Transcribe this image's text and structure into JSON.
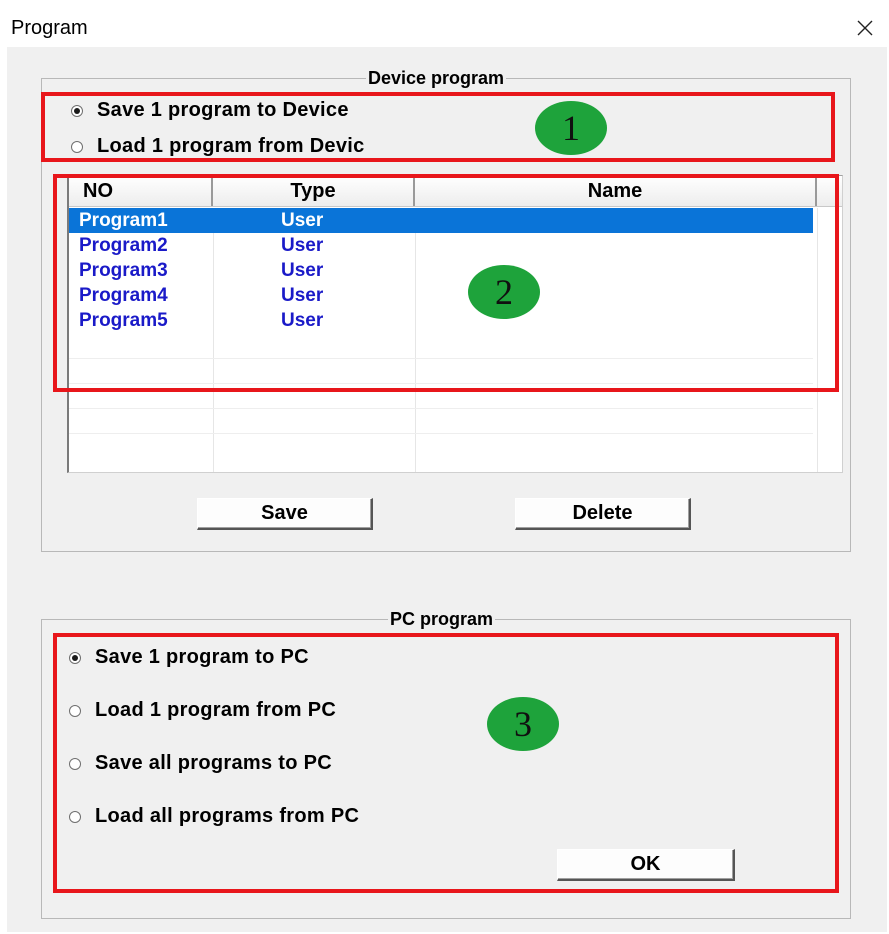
{
  "window": {
    "title": "Program"
  },
  "device_program": {
    "legend": "Device program",
    "options": [
      {
        "label": "Save 1 program to Device",
        "checked": true
      },
      {
        "label": "Load 1 program from Devic",
        "checked": false
      }
    ],
    "list": {
      "columns": [
        "NO",
        "Type",
        "Name"
      ],
      "rows": [
        {
          "no": "Program1",
          "type": "User",
          "name": "",
          "selected": true
        },
        {
          "no": "Program2",
          "type": "User",
          "name": "",
          "selected": false
        },
        {
          "no": "Program3",
          "type": "User",
          "name": "",
          "selected": false
        },
        {
          "no": "Program4",
          "type": "User",
          "name": "",
          "selected": false
        },
        {
          "no": "Program5",
          "type": "User",
          "name": "",
          "selected": false
        }
      ]
    },
    "buttons": {
      "save": "Save",
      "delete": "Delete"
    }
  },
  "pc_program": {
    "legend": "PC program",
    "options": [
      {
        "label": "Save 1 program to PC",
        "checked": true
      },
      {
        "label": "Load 1 program from PC",
        "checked": false
      },
      {
        "label": "Save all programs to PC",
        "checked": false
      },
      {
        "label": "Load all programs from PC",
        "checked": false
      }
    ],
    "ok_label": "OK"
  },
  "annotations": {
    "markers": [
      "1",
      "2",
      "3"
    ],
    "highlight_color": "#e8161b",
    "marker_color": "#1ea33b"
  },
  "colors": {
    "selection": "#0a74d8",
    "list_text": "#1a1ac8",
    "dialog_bg": "#f0f0f0"
  }
}
